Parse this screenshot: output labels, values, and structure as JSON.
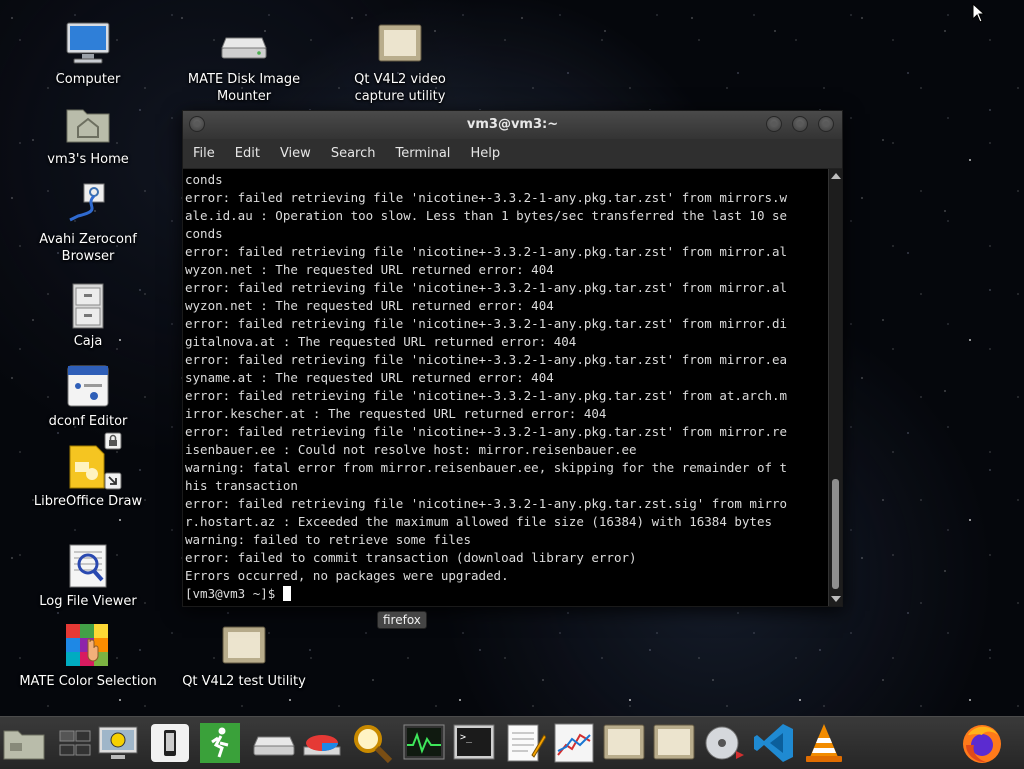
{
  "desktop": {
    "icons": [
      {
        "label": "Computer"
      },
      {
        "label": "vm3's Home"
      },
      {
        "label": "Avahi Zeroconf Browser"
      },
      {
        "label": "Caja"
      },
      {
        "label": "dconf Editor"
      },
      {
        "label": "LibreOffice Draw"
      },
      {
        "label": "Log File Viewer"
      },
      {
        "label": "MATE Color Selection"
      },
      {
        "label": "MATE Disk Image Mounter"
      },
      {
        "label": "Qt V4L2 video capture utility"
      },
      {
        "label": "Qt V4L2 test Utility"
      }
    ]
  },
  "window": {
    "title": "vm3@vm3:~",
    "menu": [
      "File",
      "Edit",
      "View",
      "Search",
      "Terminal",
      "Help"
    ]
  },
  "terminal": {
    "lines": [
      "conds",
      "error: failed retrieving file 'nicotine+-3.3.2-1-any.pkg.tar.zst' from mirrors.w",
      "ale.id.au : Operation too slow. Less than 1 bytes/sec transferred the last 10 se",
      "conds",
      "error: failed retrieving file 'nicotine+-3.3.2-1-any.pkg.tar.zst' from mirror.al",
      "wyzon.net : The requested URL returned error: 404",
      "error: failed retrieving file 'nicotine+-3.3.2-1-any.pkg.tar.zst' from mirror.al",
      "wyzon.net : The requested URL returned error: 404",
      "error: failed retrieving file 'nicotine+-3.3.2-1-any.pkg.tar.zst' from mirror.di",
      "gitalnova.at : The requested URL returned error: 404",
      "error: failed retrieving file 'nicotine+-3.3.2-1-any.pkg.tar.zst' from mirror.ea",
      "syname.at : The requested URL returned error: 404",
      "error: failed retrieving file 'nicotine+-3.3.2-1-any.pkg.tar.zst' from at.arch.m",
      "irror.kescher.at : The requested URL returned error: 404",
      "error: failed retrieving file 'nicotine+-3.3.2-1-any.pkg.tar.zst' from mirror.re",
      "isenbauer.ee : Could not resolve host: mirror.reisenbauer.ee",
      "warning: fatal error from mirror.reisenbauer.ee, skipping for the remainder of t",
      "his transaction",
      "error: failed retrieving file 'nicotine+-3.3.2-1-any.pkg.tar.zst.sig' from mirro",
      "r.hostart.az : Exceeded the maximum allowed file size (16384) with 16384 bytes",
      "warning: failed to retrieve some files",
      "error: failed to commit transaction (download library error)",
      "Errors occurred, no packages were upgraded."
    ],
    "prompt": "[vm3@vm3 ~]$ "
  },
  "tooltip": {
    "text": "firefox"
  },
  "taskbar": {
    "items": [
      {
        "icon": "show-desktop-icon"
      },
      {
        "icon": "workspace-switcher-icon"
      },
      {
        "icon": "system-monitor-icon"
      },
      {
        "icon": "phone-icon"
      },
      {
        "icon": "exit-icon"
      },
      {
        "icon": "disk-icon"
      },
      {
        "icon": "disk-usage-icon"
      },
      {
        "icon": "search-icon"
      },
      {
        "icon": "activity-monitor-icon"
      },
      {
        "icon": "terminal-icon"
      },
      {
        "icon": "text-editor-icon"
      },
      {
        "icon": "chart-icon"
      },
      {
        "icon": "video-capture-icon"
      },
      {
        "icon": "video-test-icon"
      },
      {
        "icon": "disk-mounter-icon"
      },
      {
        "icon": "vscode-icon"
      },
      {
        "icon": "vlc-icon"
      },
      {
        "icon": "firefox-icon"
      }
    ]
  }
}
